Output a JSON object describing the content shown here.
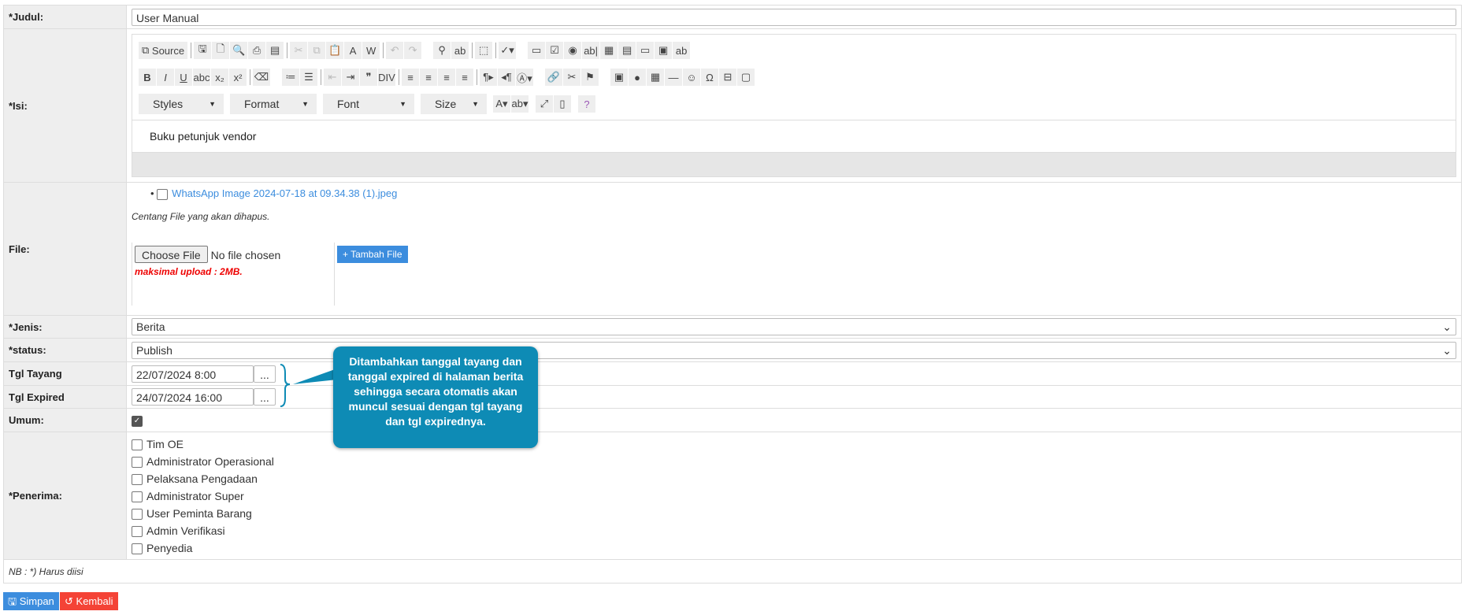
{
  "labels": {
    "judul": "*Judul:",
    "isi": "*Isi:",
    "file": "File:",
    "jenis": "*Jenis:",
    "status": "*status:",
    "tgl_tayang": "Tgl Tayang",
    "tgl_expired": "Tgl Expired",
    "umum": "Umum:",
    "penerima": "*Penerima:"
  },
  "judul_value": "User Manual",
  "editor": {
    "source_label": "Source",
    "row1": [
      "save",
      "new-page",
      "preview",
      "print",
      "templates",
      "|",
      "cut",
      "copy",
      "paste",
      "paste-text",
      "paste-word",
      "|",
      "undo",
      "redo",
      "_",
      "find",
      "replace",
      "|",
      "select-all",
      "|",
      "spellcheck",
      "_",
      "form",
      "checkbox",
      "radio",
      "text-field",
      "textarea",
      "select",
      "button",
      "image-button",
      "hidden-field"
    ],
    "row2": [
      "bold",
      "italic",
      "underline",
      "strike",
      "subscript",
      "superscript",
      "|",
      "remove-format",
      "_",
      "numbered-list",
      "bulleted-list",
      "|",
      "outdent",
      "indent",
      "blockquote",
      "div",
      "|",
      "align-left",
      "align-center",
      "align-right",
      "justify",
      "|",
      "ltr",
      "rtl",
      "language",
      "_",
      "link",
      "unlink",
      "anchor",
      "_",
      "image",
      "flash",
      "table",
      "horizontal-rule",
      "smiley",
      "special-char",
      "page-break",
      "iframe"
    ],
    "combos": [
      "Styles",
      "Format",
      "Font",
      "Size"
    ],
    "content": "Buku petunjuk vendor"
  },
  "file": {
    "existing": "WhatsApp Image 2024-07-18 at 09.34.38 (1).jpeg",
    "note": "Centang File yang akan dihapus.",
    "choose_label": "Choose File",
    "no_file": "No file chosen",
    "max_note": "maksimal upload : 2MB.",
    "add_label": "+ Tambah File"
  },
  "jenis": "Berita",
  "status": "Publish",
  "tgl_tayang": "22/07/2024 8:00",
  "tgl_expired": "24/07/2024 16:00",
  "picker_label": "...",
  "umum_checked": true,
  "penerima": [
    "Tim OE",
    "Administrator Operasional",
    "Pelaksana Pengadaan",
    "Administrator Super",
    "User Peminta Barang",
    "Admin Verifikasi",
    "Penyedia"
  ],
  "nb": "NB : *) Harus diisi",
  "buttons": {
    "save": "Simpan",
    "back": "Kembali"
  },
  "callout": "Ditambahkan tanggal tayang dan tanggal expired di halaman berita sehingga secara otomatis akan muncul sesuai dengan tgl tayang dan tgl expirednya.",
  "colors": {
    "primary": "#3c8dde",
    "danger": "#f44336",
    "callout": "#0e8bb5",
    "link": "#3c8dde"
  }
}
